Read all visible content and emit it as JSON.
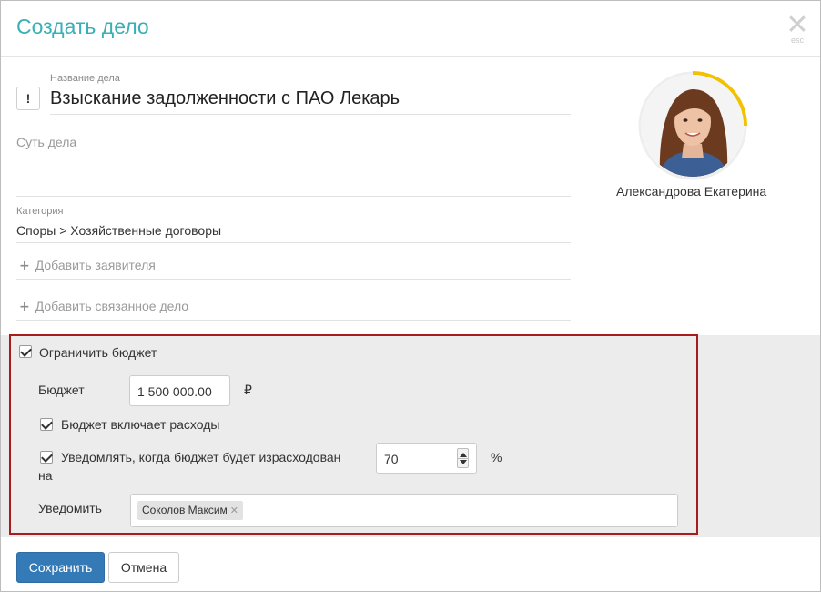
{
  "dialog": {
    "title": "Создать дело",
    "close_icon": "close-icon",
    "close_hint": "esc"
  },
  "form": {
    "name_label": "Название дела",
    "importance_glyph": "!",
    "name_value": "Взыскание задолженности с ПАО Лекарь",
    "essence_placeholder": "Суть дела",
    "category_label": "Категория",
    "category_value": "Споры > Хозяйственные договоры",
    "add_applicant": "Добавить заявителя",
    "add_related": "Добавить связанное дело",
    "plus_glyph": "+"
  },
  "responsible": {
    "name": "Александрова Екатерина",
    "ring_color": "#f2c200"
  },
  "budget": {
    "limit_label": "Ограничить бюджет",
    "limit_checked": true,
    "budget_label": "Бюджет",
    "budget_value": "1 500 000.00",
    "currency": "₽",
    "includes_expenses_label": "Бюджет включает расходы",
    "includes_expenses_checked": true,
    "notify_line1": "Уведомлять, когда бюджет будет израсходован",
    "notify_line2": "на",
    "notify_checked": true,
    "notify_percent": "70",
    "percent_sign": "%",
    "notify_whom_label": "Уведомить",
    "notify_tags": [
      "Соколов Максим"
    ],
    "highlight_color": "#a61d1d"
  },
  "actions": {
    "save": "Сохранить",
    "cancel": "Отмена"
  },
  "colors": {
    "title": "#3aafb5",
    "primary_button": "#337ab7",
    "budget_zone_bg": "#ececec"
  }
}
